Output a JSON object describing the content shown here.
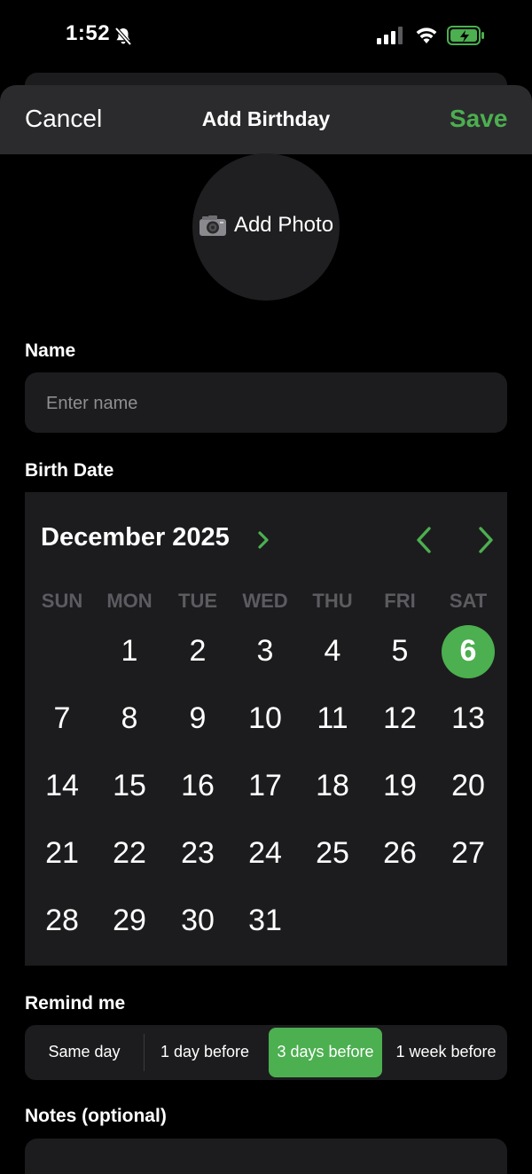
{
  "status_bar": {
    "time": "1:52",
    "icons": [
      "bell-slash-icon",
      "cellular-signal-icon",
      "wifi-icon",
      "battery-charging-icon"
    ]
  },
  "nav": {
    "cancel_label": "Cancel",
    "title": "Add Birthday",
    "save_label": "Save"
  },
  "photo": {
    "label": "Add Photo",
    "icon": "camera-icon"
  },
  "name": {
    "label": "Name",
    "placeholder": "Enter name",
    "value": ""
  },
  "birth_date": {
    "label": "Birth Date",
    "month_year": "December 2025",
    "weekdays": [
      "SUN",
      "MON",
      "TUE",
      "WED",
      "THU",
      "FRI",
      "SAT"
    ],
    "days": [
      "1",
      "2",
      "3",
      "4",
      "5",
      "6",
      "7",
      "8",
      "9",
      "10",
      "11",
      "12",
      "13",
      "14",
      "15",
      "16",
      "17",
      "18",
      "19",
      "20",
      "21",
      "22",
      "23",
      "24",
      "25",
      "26",
      "27",
      "28",
      "29",
      "30",
      "31"
    ],
    "selected_day": "6"
  },
  "remind": {
    "label": "Remind me",
    "options": [
      "Same day",
      "1 day before",
      "3 days before",
      "1 week before"
    ],
    "selected": "3 days before"
  },
  "notes": {
    "label": "Notes (optional)"
  },
  "colors": {
    "accent": "#4CAF50",
    "background": "#000000",
    "surface": "#1c1c1e",
    "nav": "#2b2b2d",
    "muted_text": "#8e8e93",
    "weekday_text": "#5b5b60"
  }
}
